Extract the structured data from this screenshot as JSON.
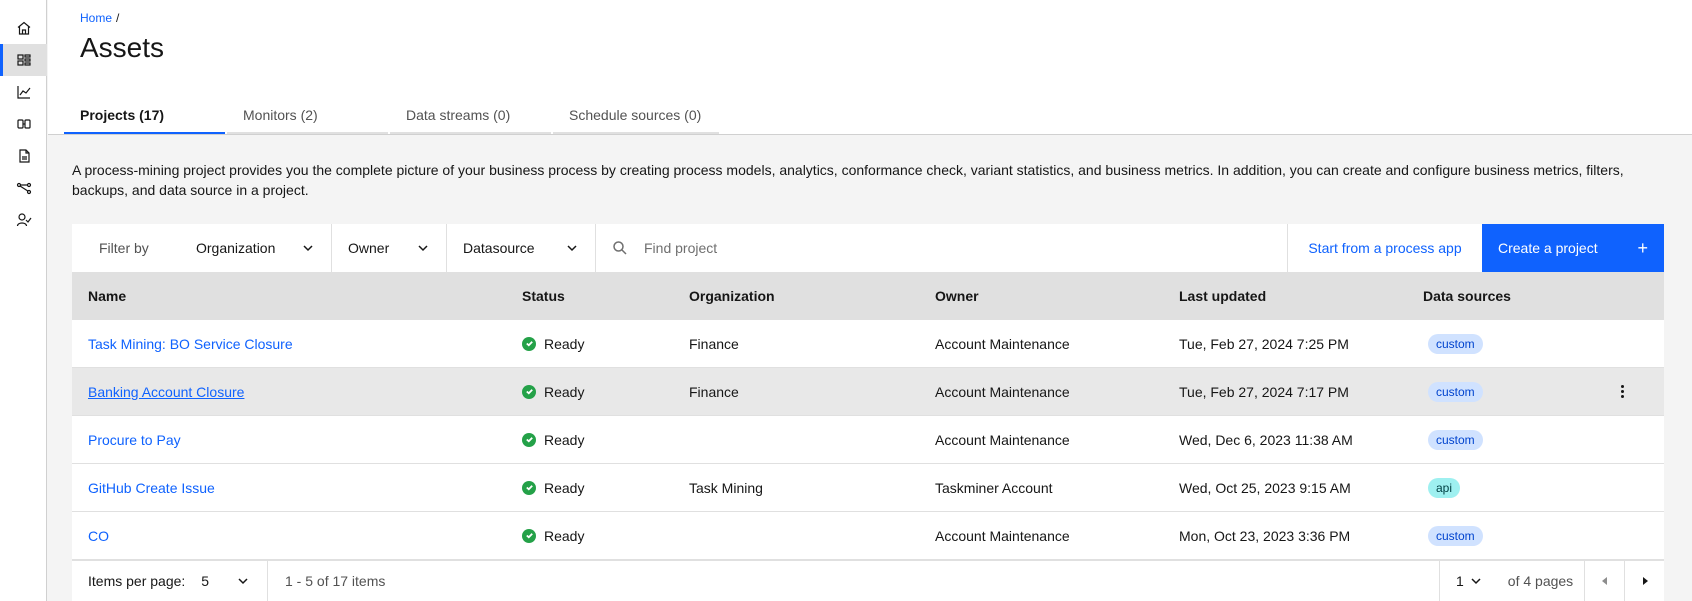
{
  "rail": {
    "items": [
      {
        "name": "home-icon"
      },
      {
        "name": "assets-icon",
        "active": true
      },
      {
        "name": "analytics-icon"
      },
      {
        "name": "compare-icon"
      },
      {
        "name": "document-icon"
      },
      {
        "name": "workflow-icon"
      },
      {
        "name": "user-access-icon"
      }
    ]
  },
  "header": {
    "breadcrumb": {
      "home": "Home",
      "separator": "/"
    },
    "title": "Assets",
    "tabs": [
      {
        "label": "Projects (17)",
        "active": true
      },
      {
        "label": "Monitors (2)"
      },
      {
        "label": "Data streams (0)"
      },
      {
        "label": "Schedule sources (0)"
      }
    ]
  },
  "description": "A process-mining project provides you the complete picture of your business process by creating process models, analytics, conformance check, variant statistics, and business metrics. In addition, you can create and configure business metrics, filters, backups, and data source in a project.",
  "toolbar": {
    "filter_by": "Filter by",
    "organization": "Organization",
    "owner": "Owner",
    "datasource": "Datasource",
    "search_placeholder": "Find project",
    "start_from_app": "Start from a process app",
    "create_project": "Create a project",
    "create_icon": "+"
  },
  "table": {
    "headers": {
      "name": "Name",
      "status": "Status",
      "organization": "Organization",
      "owner": "Owner",
      "last_updated": "Last updated",
      "data_sources": "Data sources"
    },
    "rows": [
      {
        "name": "Task Mining: BO Service Closure",
        "status": "Ready",
        "organization": "Finance",
        "owner": "Account Maintenance",
        "last_updated": "Tue, Feb 27, 2024 7:25 PM",
        "data_source": "custom"
      },
      {
        "name": "Banking Account Closure",
        "status": "Ready",
        "organization": "Finance",
        "owner": "Account Maintenance",
        "last_updated": "Tue, Feb 27, 2024 7:17 PM",
        "data_source": "custom",
        "hover": true
      },
      {
        "name": "Procure to Pay",
        "status": "Ready",
        "organization": "",
        "owner": "Account Maintenance",
        "last_updated": "Wed, Dec 6, 2023 11:38 AM",
        "data_source": "custom"
      },
      {
        "name": "GitHub Create Issue",
        "status": "Ready",
        "organization": "Task Mining",
        "owner": "Taskminer Account",
        "last_updated": "Wed, Oct 25, 2023 9:15 AM",
        "data_source": "api"
      },
      {
        "name": "CO",
        "status": "Ready",
        "organization": "",
        "owner": "Account Maintenance",
        "last_updated": "Mon, Oct 23, 2023 3:36 PM",
        "data_source": "custom"
      }
    ]
  },
  "pagination": {
    "items_per_page_label": "Items per page:",
    "items_per_page": "5",
    "range": "1 - 5 of 17 items",
    "current_page": "1",
    "of_pages": "of 4 pages"
  },
  "colors": {
    "accent": "#0f62fe",
    "status_ready": "#24a148",
    "tag_custom_bg": "#d0e2ff",
    "tag_api_bg": "#9ef0f0"
  }
}
